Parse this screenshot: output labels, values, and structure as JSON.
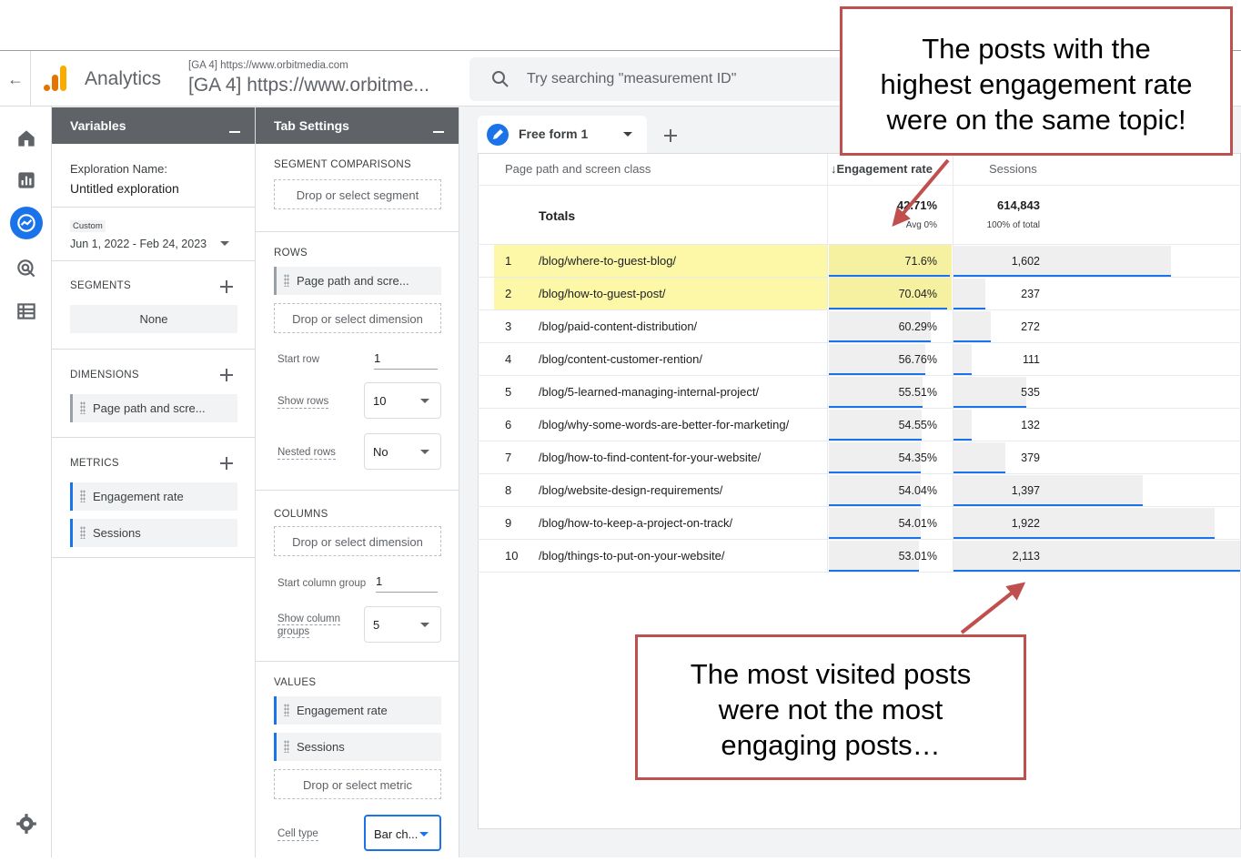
{
  "header": {
    "back_icon": "arrow-back-icon",
    "brand": "Analytics",
    "property_small": "[GA 4] https://www.orbitmedia.com",
    "property_big": "[GA 4] https://www.orbitme...",
    "search_placeholder": "Try searching \"measurement ID\""
  },
  "rail": {
    "icons": [
      "home-icon",
      "reports-icon",
      "explore-icon",
      "advertising-icon",
      "configure-icon",
      "settings-icon"
    ]
  },
  "variables": {
    "title": "Variables",
    "exploration_name_label": "Exploration Name:",
    "exploration_name": "Untitled exploration",
    "date_tag": "Custom",
    "date_range": "Jun 1, 2022 - Feb 24, 2023",
    "segments_label": "SEGMENTS",
    "segments_value": "None",
    "dimensions_label": "DIMENSIONS",
    "dimension": "Page path and scre...",
    "metrics_label": "METRICS",
    "metric1": "Engagement rate",
    "metric2": "Sessions"
  },
  "tab_settings": {
    "title": "Tab Settings",
    "segment_comparisons_label": "SEGMENT COMPARISONS",
    "segment_drop": "Drop or select segment",
    "rows_label": "ROWS",
    "row_dimension": "Page path and scre...",
    "row_drop": "Drop or select dimension",
    "start_row_label": "Start row",
    "start_row": "1",
    "show_rows_label": "Show rows",
    "show_rows": "10",
    "nested_rows_label": "Nested rows",
    "nested_rows": "No",
    "columns_label": "COLUMNS",
    "column_drop": "Drop or select dimension",
    "start_col_group_label": "Start column group",
    "start_col_group": "1",
    "show_col_groups_label1": "Show column",
    "show_col_groups_label2": "groups",
    "show_col_groups": "5",
    "values_label": "VALUES",
    "value1": "Engagement rate",
    "value2": "Sessions",
    "value_drop": "Drop or select metric",
    "cell_type_label": "Cell type",
    "cell_type": "Bar ch..."
  },
  "report": {
    "tab_name": "Free form 1",
    "col_dimension": "Page path and screen class",
    "col_engagement": "↓Engagement rate",
    "col_sessions": "Sessions",
    "totals_label": "Totals",
    "totals_engagement": "42.71%",
    "totals_engagement_sub": "Avg 0%",
    "totals_sessions": "614,843",
    "totals_sessions_sub": "100% of total",
    "rows": [
      {
        "n": "1",
        "path": "/blog/where-to-guest-blog/",
        "eng": "71.6%",
        "eng_v": 71.6,
        "sess": "1,602",
        "sess_v": 1602
      },
      {
        "n": "2",
        "path": "/blog/how-to-guest-post/",
        "eng": "70.04%",
        "eng_v": 70.04,
        "sess": "237",
        "sess_v": 237
      },
      {
        "n": "3",
        "path": "/blog/paid-content-distribution/",
        "eng": "60.29%",
        "eng_v": 60.29,
        "sess": "272",
        "sess_v": 272
      },
      {
        "n": "4",
        "path": "/blog/content-customer-rention/",
        "eng": "56.76%",
        "eng_v": 56.76,
        "sess": "111",
        "sess_v": 111
      },
      {
        "n": "5",
        "path": "/blog/5-learned-managing-internal-project/",
        "eng": "55.51%",
        "eng_v": 55.51,
        "sess": "535",
        "sess_v": 535
      },
      {
        "n": "6",
        "path": "/blog/why-some-words-are-better-for-marketing/",
        "eng": "54.55%",
        "eng_v": 54.55,
        "sess": "132",
        "sess_v": 132
      },
      {
        "n": "7",
        "path": "/blog/how-to-find-content-for-your-website/",
        "eng": "54.35%",
        "eng_v": 54.35,
        "sess": "379",
        "sess_v": 379
      },
      {
        "n": "8",
        "path": "/blog/website-design-requirements/",
        "eng": "54.04%",
        "eng_v": 54.04,
        "sess": "1,397",
        "sess_v": 1397
      },
      {
        "n": "9",
        "path": "/blog/how-to-keep-a-project-on-track/",
        "eng": "54.01%",
        "eng_v": 54.01,
        "sess": "1,922",
        "sess_v": 1922
      },
      {
        "n": "10",
        "path": "/blog/things-to-put-on-your-website/",
        "eng": "53.01%",
        "eng_v": 53.01,
        "sess": "2,113",
        "sess_v": 2113
      }
    ]
  },
  "callouts": {
    "top_line1": "The posts with the",
    "top_line2": "highest engagement rate",
    "top_line3": "were on the same topic!",
    "bottom_line1": "The most visited posts",
    "bottom_line2": "were not the most",
    "bottom_line3": "engaging posts…"
  },
  "colors": {
    "accent": "#1a73e8",
    "highlight": "#fcf8a7",
    "callout_border": "#c0504d",
    "panel_header": "#5f6368"
  }
}
